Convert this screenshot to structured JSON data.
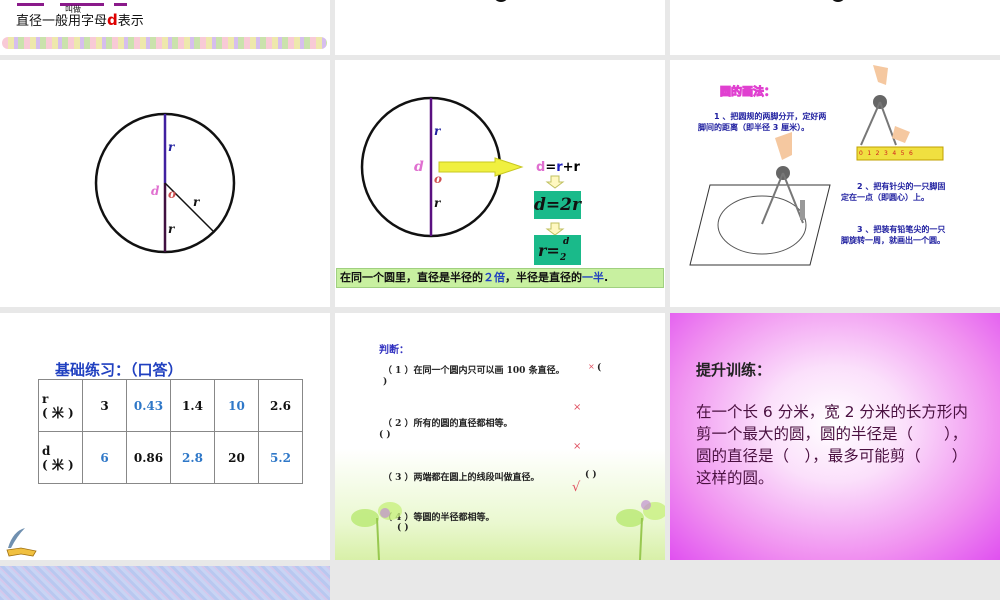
{
  "slide1": {
    "text_prefix": "直径一般用字母",
    "letter": "d",
    "text_suffix": "表示",
    "overlay": "叫做"
  },
  "slide4": {
    "r_top": "r",
    "d": "d",
    "o": "o",
    "r_side": "r",
    "r_bottom": "r"
  },
  "slide5": {
    "r_top": "r",
    "d": "d",
    "o": "o",
    "r_bottom": "r",
    "eq1_d": "d",
    "eq1_rest": "=",
    "eq1_r": "r",
    "eq1_tail": "+r",
    "eq2": "d=2r",
    "eq3_r": "r=",
    "eq3_num": "d",
    "eq3_den": "2",
    "summary_a": "在同一个圆里，直径是半径的",
    "summary_b": "２倍",
    "summary_c": "，半径是直径的",
    "summary_d": "一半",
    "summary_e": "."
  },
  "slide6": {
    "title": "圆的画法：",
    "step1": "1 、把圆规的两脚分开，定好两脚间的距离（即半径 3 厘米）。",
    "step2": "2 、把有针尖的一只脚固定在一点（即圆心）上。",
    "step3": "3 、把装有铅笔尖的一只脚旋转一周，就画出一个圆。",
    "ruler": [
      "0",
      "1",
      "2",
      "3",
      "4",
      "5",
      "6"
    ]
  },
  "slide7": {
    "title": "基础练习：（口答）",
    "rows": [
      {
        "label": "r",
        "unit": "( 米 )",
        "cells": [
          {
            "v": "3",
            "blue": false
          },
          {
            "v": "0.43",
            "blue": true
          },
          {
            "v": "1.4",
            "blue": false
          },
          {
            "v": "10",
            "blue": true
          },
          {
            "v": "2.6",
            "blue": false
          }
        ]
      },
      {
        "label": "d",
        "unit": "( 米 )",
        "cells": [
          {
            "v": "6",
            "blue": true
          },
          {
            "v": "0.86",
            "blue": false
          },
          {
            "v": "2.8",
            "blue": true
          },
          {
            "v": "20",
            "blue": false
          },
          {
            "v": "5.2",
            "blue": true
          }
        ]
      }
    ]
  },
  "slide8": {
    "title": "判断：",
    "q1": "（ 1 ）在同一个圆内只可以画 100 条直径。",
    "q1_tail": "(",
    "q1_close": ")",
    "q2": "（ 2 ）所有的圆的直径都相等。",
    "q2_paren": "(       )",
    "q3": "（ 3 ）两端都在圆上的线段叫做直径。",
    "q3_paren": "(       )",
    "q4": "（ 4 ）等圆的半径都相等。",
    "q4_paren": "(       )",
    "mark1": "×",
    "mark2": "×",
    "mark3": "×",
    "mark4": "√"
  },
  "slide9": {
    "title": "提升训练：",
    "body": "在一个长 6 分米，宽 2 分米的长方形内剪一个最大的圆，圆的半径是（　　），圆的直径是（　），最多可能剪（　　）这样的圆。"
  }
}
